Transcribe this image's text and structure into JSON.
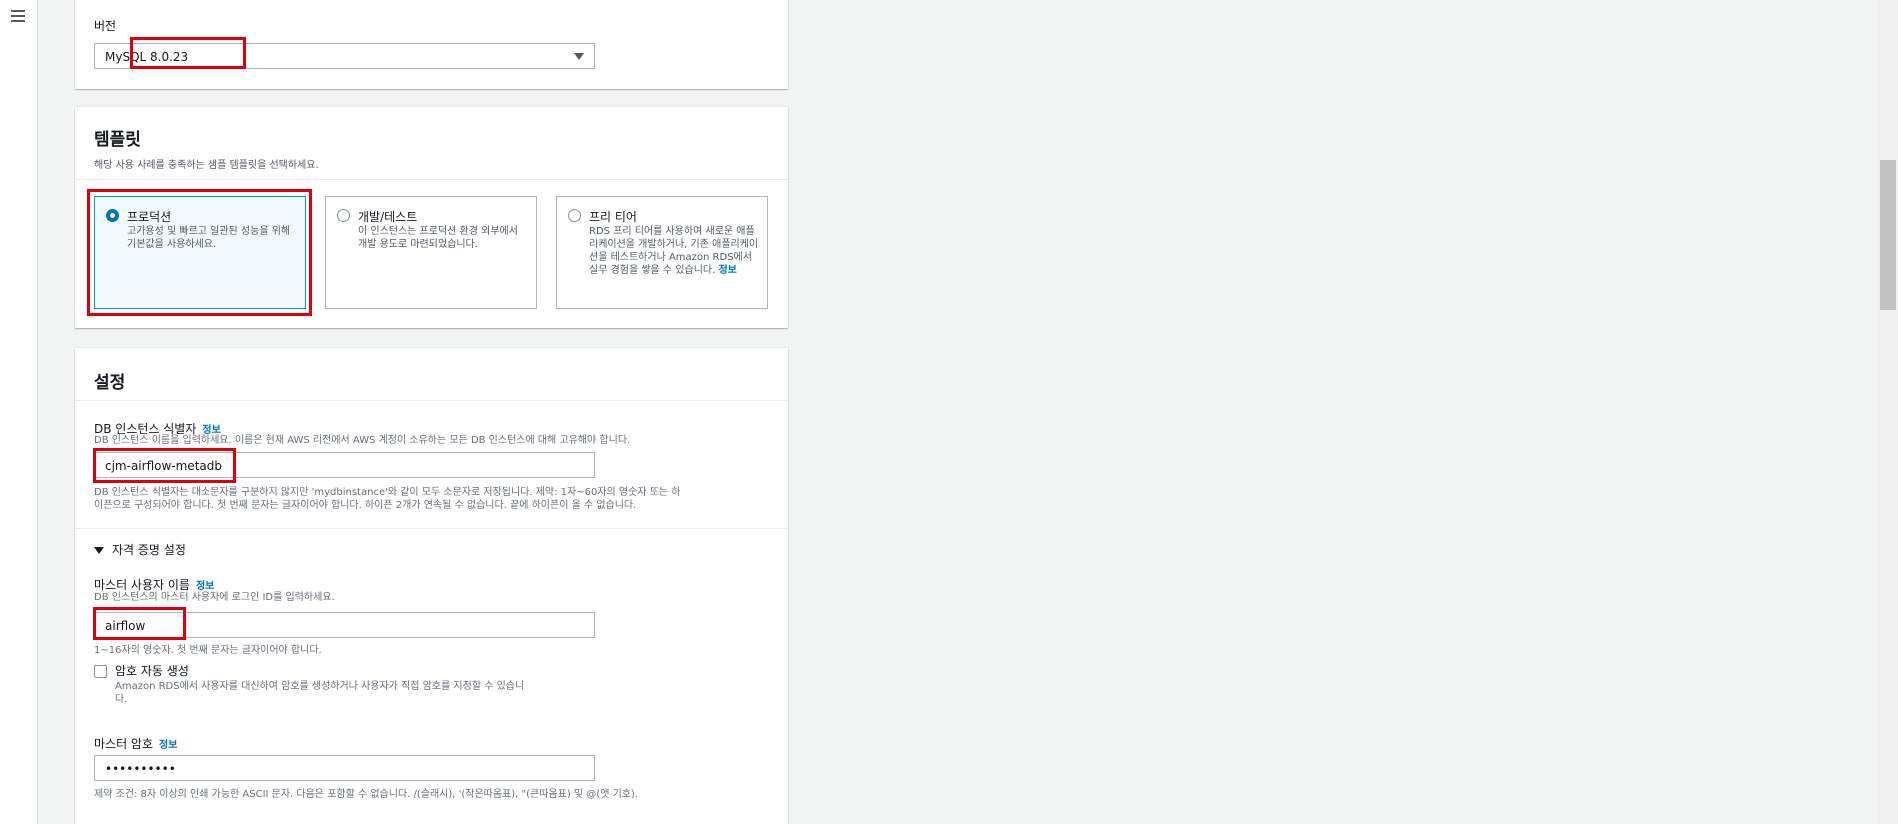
{
  "version": {
    "label": "버전",
    "value": "MySQL 8.0.23"
  },
  "template": {
    "title": "템플릿",
    "description": "해당 사용 사례를 충족하는 샘플 템플릿을 선택하세요.",
    "options": [
      {
        "title": "프로덕션",
        "description": "고가용성 및 빠르고 일관된 성능을 위해 기본값을 사용하세요.",
        "selected": true
      },
      {
        "title": "개발/테스트",
        "description": "이 인스턴스는 프로덕션 환경 외부에서 개발 용도로 마련되었습니다.",
        "selected": false
      },
      {
        "title": "프리 티어",
        "description": "RDS 프리 티어를 사용하여 새로운 애플리케이션을 개발하거나, 기존 애플리케이션을 테스트하거나 Amazon RDS에서 실무 경험을 쌓을 수 있습니다.",
        "link": "정보",
        "selected": false
      }
    ]
  },
  "settings": {
    "title": "설정",
    "identifier": {
      "label": "DB 인스턴스 식별자",
      "info": "정보",
      "description": "DB 인스턴스 이름을 입력하세요. 이름은 현재 AWS 리전에서 AWS 계정이 소유하는 모든 DB 인스턴스에 대해 고유해야 합니다.",
      "value": "cjm-airflow-metadb",
      "constraint_line1": "DB 인스턴스 식별자는 대소문자를 구분하지 않지만 'mydbinstance'와 같이 모두 소문자로 저장됩니다. 제약: 1자~60자의 영숫자 또는 하",
      "constraint_line2": "이픈으로 구성되어야 합니다. 첫 번째 문자는 글자이어야 합니다. 하이픈 2개가 연속될 수 없습니다. 끝에 하이픈이 올 수 없습니다."
    },
    "credentials": {
      "section_title": "자격 증명 설정",
      "username_label": "마스터 사용자 이름",
      "username_info": "정보",
      "username_description": "DB 인스턴스의 마스터 사용자에 로그인 ID를 입력하세요.",
      "username_value": "airflow",
      "username_constraint": "1~16자의 영숫자. 첫 번째 문자는 글자이어야 합니다.",
      "auto_password_label": "암호 자동 생성",
      "auto_password_desc_line1": "Amazon RDS에서 사용자를 대신하여 암호를 생성하거나 사용자가 직접 암호를 지정할 수 있습니",
      "auto_password_desc_line2": "다.",
      "password_label": "마스터 암호",
      "password_info": "정보",
      "password_value": "••••••••••",
      "password_constraint": "제약 조건: 8자 이상의 인쇄 가능한 ASCII 문자. 다음은 포함할 수 없습니다. /(슬래시), '(작은따옴표), \"(큰따옴표) 및 @(앳 기호)."
    }
  }
}
